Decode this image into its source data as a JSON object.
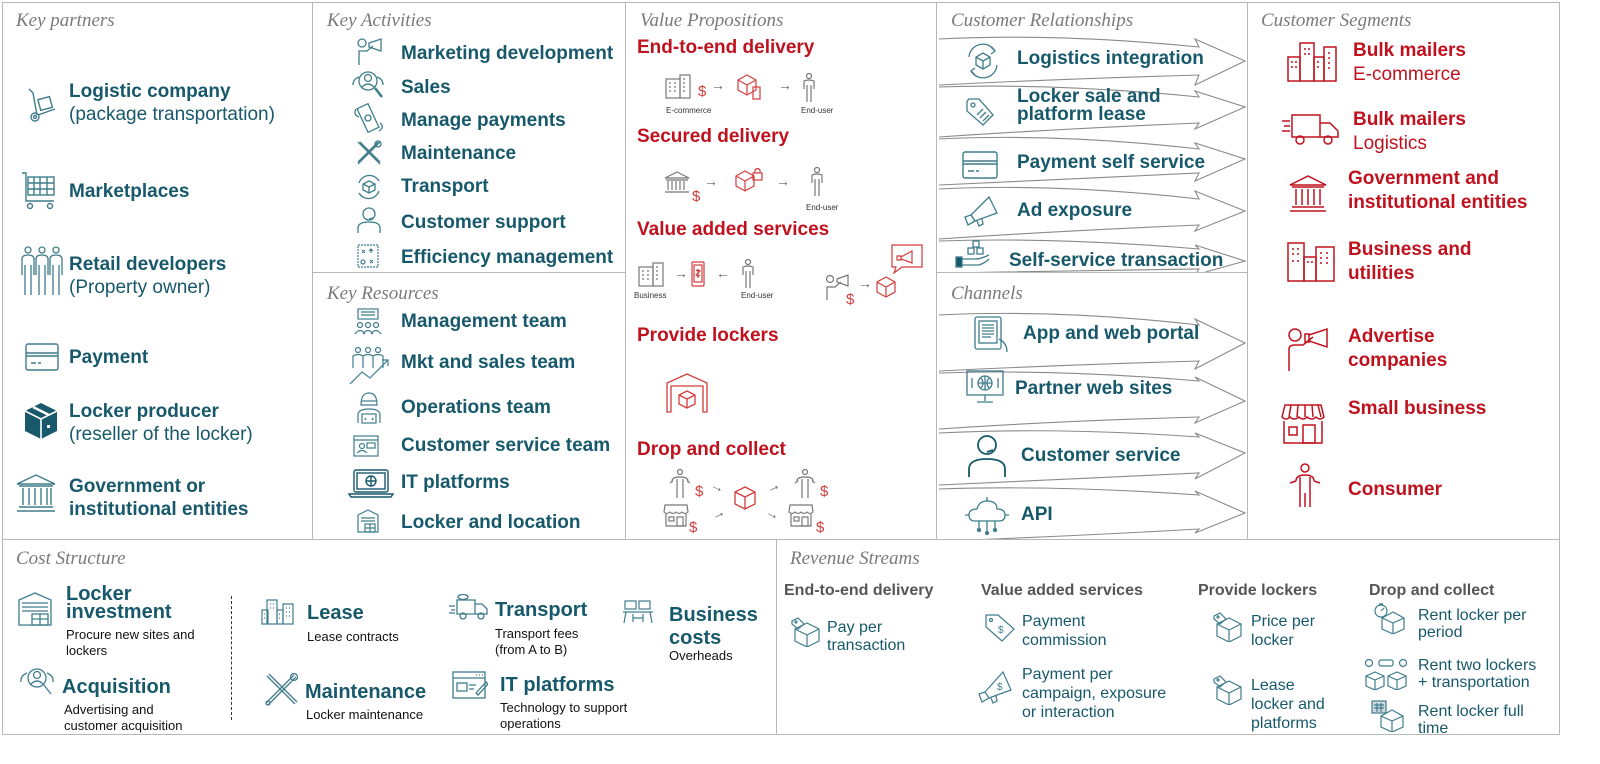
{
  "colors": {
    "teal": "#17596b",
    "red": "#c0121e",
    "border": "#b8b8b8",
    "section_title": "#7a7a7a"
  },
  "key_partners": {
    "title": "Key partners",
    "items": [
      {
        "icon": "hand-truck-icon",
        "main": "Logistic company",
        "sub": "(package transportation)"
      },
      {
        "icon": "shopping-cart-icon",
        "main": "Marketplaces",
        "sub": ""
      },
      {
        "icon": "people-group-icon",
        "main": "Retail developers",
        "sub": "(Property owner)"
      },
      {
        "icon": "credit-card-icon",
        "main": "Payment",
        "sub": ""
      },
      {
        "icon": "package-box-icon",
        "main": "Locker producer",
        "sub": "(reseller of the locker)"
      },
      {
        "icon": "institution-building-icon",
        "main": "Government or",
        "sub2": "institutional entities"
      }
    ]
  },
  "key_activities": {
    "title": "Key Activities",
    "items": [
      {
        "icon": "megaphone-person-icon",
        "label": "Marketing development"
      },
      {
        "icon": "sales-search-icon",
        "label": "Sales"
      },
      {
        "icon": "flying-money-icon",
        "label": "Manage payments"
      },
      {
        "icon": "tools-icon",
        "label": "Maintenance"
      },
      {
        "icon": "package-cycle-icon",
        "label": "Transport"
      },
      {
        "icon": "headset-person-icon",
        "label": "Customer support"
      },
      {
        "icon": "strategy-board-icon",
        "label": "Efficiency management"
      }
    ]
  },
  "key_resources": {
    "title": "Key Resources",
    "items": [
      {
        "icon": "team-presentation-icon",
        "label": "Management team"
      },
      {
        "icon": "growth-team-icon",
        "label": "Mkt and sales team"
      },
      {
        "icon": "developer-icon",
        "label": "Operations team"
      },
      {
        "icon": "chat-window-icon",
        "label": "Customer service team"
      },
      {
        "icon": "laptop-globe-icon",
        "label": "IT platforms"
      },
      {
        "icon": "locker-warehouse-icon",
        "label": "Locker and location"
      }
    ]
  },
  "value_propositions": {
    "title": "Value Propositions",
    "items": [
      {
        "label": "End-to-end delivery",
        "caption_left": "E-commerce",
        "caption_right": "End-user"
      },
      {
        "label": "Secured delivery",
        "caption_right": "End-user"
      },
      {
        "label": "Value added services",
        "caption_left": "Business",
        "caption_right": "End-user"
      },
      {
        "label": "Provide lockers"
      },
      {
        "label": "Drop and collect"
      }
    ],
    "dollar": "$",
    "arrow": "→",
    "arrow_back": "←"
  },
  "customer_relationships": {
    "title": "Customer Relationships",
    "items": [
      {
        "icon": "package-cycle-icon",
        "label": "Logistics integration"
      },
      {
        "icon": "price-tag-icon",
        "label": "Locker sale and",
        "label2": "platform lease"
      },
      {
        "icon": "credit-card-icon",
        "label": "Payment self service"
      },
      {
        "icon": "megaphone-icon",
        "label": "Ad exposure"
      },
      {
        "icon": "hand-boxes-icon",
        "label": "Self-service transaction"
      }
    ]
  },
  "channels": {
    "title": "Channels",
    "items": [
      {
        "icon": "tablet-hand-icon",
        "label": "App and web portal"
      },
      {
        "icon": "monitor-globe-icon",
        "label": "Partner web sites"
      },
      {
        "icon": "headset-person-icon",
        "label": "Customer service"
      },
      {
        "icon": "cloud-network-icon",
        "label": "API"
      }
    ]
  },
  "customer_segments": {
    "title": "Customer Segments",
    "items": [
      {
        "icon": "city-buildings-icon",
        "main": "Bulk mailers",
        "sub": "E-commerce"
      },
      {
        "icon": "delivery-truck-icon",
        "main": "Bulk mailers",
        "sub": "Logistics"
      },
      {
        "icon": "institution-building-icon",
        "main": "Government and",
        "main2": "institutional entities"
      },
      {
        "icon": "city-buildings-icon",
        "main": "Business and",
        "main2": "utilities"
      },
      {
        "icon": "megaphone-person-icon",
        "main": "Advertise",
        "main2": "companies"
      },
      {
        "icon": "storefront-icon",
        "main": "Small business"
      },
      {
        "icon": "person-icon",
        "main": "Consumer"
      }
    ]
  },
  "cost_structure": {
    "title": "Cost Structure",
    "items": [
      {
        "icon": "locker-warehouse-icon",
        "main": "Locker",
        "main2": "investment",
        "sub": "Procure new sites and",
        "sub2": "lockers"
      },
      {
        "icon": "sales-search-icon",
        "main": "Acquisition",
        "sub": "Advertising and",
        "sub2": "customer acquisition"
      },
      {
        "icon": "city-buildings-icon",
        "main": "Lease",
        "sub": "Lease contracts"
      },
      {
        "icon": "tools-icon",
        "main": "Maintenance",
        "sub": "Locker maintenance"
      },
      {
        "icon": "delivery-truck-icon",
        "main": "Transport",
        "sub": "Transport fees",
        "sub2": "(from A to B)"
      },
      {
        "icon": "browser-edit-icon",
        "main": "IT platforms",
        "sub": "Technology to support",
        "sub2": "operations"
      },
      {
        "icon": "office-desks-icon",
        "main": "Business",
        "main2": "costs",
        "sub": "Overheads"
      }
    ]
  },
  "revenue_streams": {
    "title": "Revenue Streams",
    "columns": [
      {
        "heading": "End-to-end delivery",
        "items": [
          {
            "icon": "box-tag-icon",
            "line1": "Pay per",
            "line2": "transaction"
          }
        ]
      },
      {
        "heading": "Value added services",
        "items": [
          {
            "icon": "dollar-tag-icon",
            "line1": "Payment",
            "line2": "commission"
          },
          {
            "icon": "dollar-megaphone-icon",
            "line1": "Payment per",
            "line2": "campaign, exposure",
            "line3": "or interaction"
          }
        ]
      },
      {
        "heading": "Provide lockers",
        "items": [
          {
            "icon": "box-tag-icon",
            "line1": "Price per",
            "line2": "locker"
          },
          {
            "icon": "box-tag-icon",
            "line1": "Lease",
            "line2": "locker and",
            "line3": "platforms"
          }
        ]
      },
      {
        "heading": "Drop and collect",
        "items": [
          {
            "icon": "timer-box-icon",
            "line1": "Rent locker per",
            "line2": "period"
          },
          {
            "icon": "two-boxes-truck-icon",
            "line1": "Rent two lockers",
            "line2": "+ transportation"
          },
          {
            "icon": "calendar-box-icon",
            "line1": "Rent locker full",
            "line2": "time"
          }
        ]
      }
    ]
  }
}
